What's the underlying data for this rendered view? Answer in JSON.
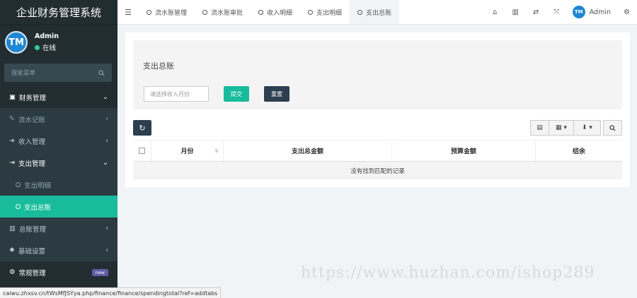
{
  "app": {
    "title": "企业财务管理系统"
  },
  "user": {
    "name": "Admin",
    "status": "在线",
    "avatar_initials": "TM"
  },
  "sidebar": {
    "search_placeholder": "搜索菜单",
    "items": [
      {
        "label": "财务管理",
        "icon": "money-icon",
        "arrow": "⌄"
      },
      {
        "label": "流水记账",
        "icon": "edit-icon",
        "arrow": "‹"
      },
      {
        "label": "收入管理",
        "icon": "sign-in-icon",
        "arrow": "‹"
      },
      {
        "label": "支出管理",
        "icon": "sign-out-icon",
        "arrow": "⌄"
      },
      {
        "label": "支出明细",
        "icon": "circle-icon"
      },
      {
        "label": "支出总账",
        "icon": "circle-icon"
      },
      {
        "label": "总账管理",
        "icon": "bar-chart-icon",
        "arrow": "‹"
      },
      {
        "label": "基础设置",
        "icon": "gear-icon",
        "arrow": "‹"
      },
      {
        "label": "常规管理",
        "icon": "cogs-icon",
        "badge": "new"
      }
    ]
  },
  "topbar": {
    "tabs": [
      {
        "label": "流水账管理"
      },
      {
        "label": "流水账审批"
      },
      {
        "label": "收入明细"
      },
      {
        "label": "支出明细"
      },
      {
        "label": "支出总账"
      }
    ],
    "user_name": "Admin"
  },
  "content": {
    "title": "支出总账",
    "month_placeholder": "请选择收入月份",
    "submit_label": "提交",
    "reset_label": "重置",
    "table": {
      "columns": [
        "月份",
        "支出总金额",
        "预算金额",
        "结余"
      ],
      "empty_text": "没有找到匹配的记录"
    }
  },
  "watermark": "https://www.huzhan.com/ishop289",
  "status_url": "caiwu.zhxsv.cn/tWsMfJSYya.php/finance/finance/spendingtotal?ref=addtabs",
  "colors": {
    "sidebar_bg": "#222d32",
    "accent": "#18bc9c",
    "dark_button": "#2c3e50"
  }
}
